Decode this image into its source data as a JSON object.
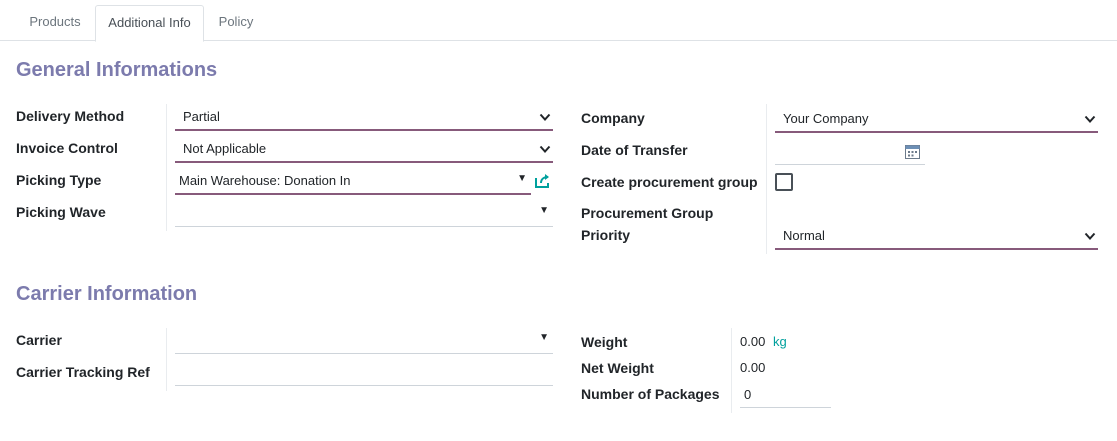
{
  "tabs": [
    {
      "label": "Products"
    },
    {
      "label": "Additional Info"
    },
    {
      "label": "Policy"
    }
  ],
  "general": {
    "title": "General Informations",
    "left": {
      "delivery_method": {
        "label": "Delivery Method",
        "value": "Partial"
      },
      "invoice_control": {
        "label": "Invoice Control",
        "value": "Not Applicable"
      },
      "picking_type": {
        "label": "Picking Type",
        "value": "Main Warehouse: Donation In"
      },
      "picking_wave": {
        "label": "Picking Wave",
        "value": ""
      }
    },
    "right": {
      "company": {
        "label": "Company",
        "value": "Your Company"
      },
      "date_of_transfer": {
        "label": "Date of Transfer",
        "value": ""
      },
      "create_procurement_group": {
        "label": "Create procurement group",
        "checked": false
      },
      "procurement_group_priority": {
        "label_line1": "Procurement Group",
        "label_line2": "Priority",
        "value": "Normal"
      }
    }
  },
  "carrier": {
    "title": "Carrier Information",
    "left": {
      "carrier": {
        "label": "Carrier",
        "value": ""
      },
      "tracking_ref": {
        "label": "Carrier Tracking Ref",
        "value": ""
      }
    },
    "right": {
      "weight": {
        "label": "Weight",
        "value": "0.00",
        "unit": "kg"
      },
      "net_weight": {
        "label": "Net Weight",
        "value": "0.00"
      },
      "packages": {
        "label": "Number of Packages",
        "value": "0"
      }
    }
  },
  "icons": {
    "external_link": "external-link-icon",
    "calendar": "calendar-icon",
    "chevron": "chevron-down-icon"
  },
  "colors": {
    "accent": "#875a7b",
    "section_title": "#7c7bad",
    "link_teal": "#00a09d"
  }
}
